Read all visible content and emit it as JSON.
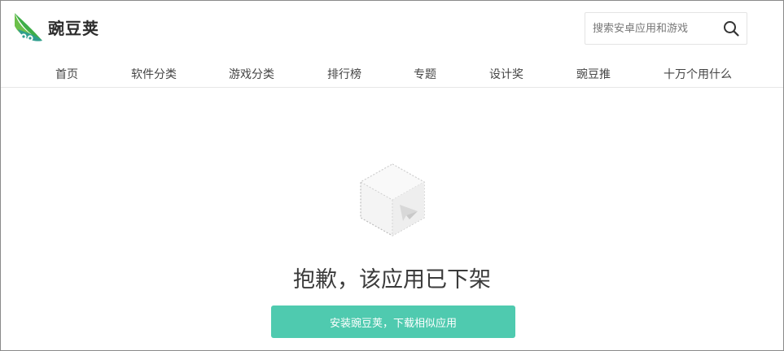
{
  "brand": {
    "name": "豌豆荚",
    "color": "#4fcaaf"
  },
  "search": {
    "placeholder": "搜索安卓应用和游戏",
    "icon": "search-icon"
  },
  "nav": {
    "items": [
      {
        "label": "首页"
      },
      {
        "label": "软件分类"
      },
      {
        "label": "游戏分类"
      },
      {
        "label": "排行榜"
      },
      {
        "label": "专题"
      },
      {
        "label": "设计奖"
      },
      {
        "label": "豌豆推"
      },
      {
        "label": "十万个用什么"
      }
    ]
  },
  "main": {
    "empty_icon": "dotted-box-icon",
    "message": "抱歉，该应用已下架",
    "install_button": "安装豌豆荚，下载相似应用"
  }
}
